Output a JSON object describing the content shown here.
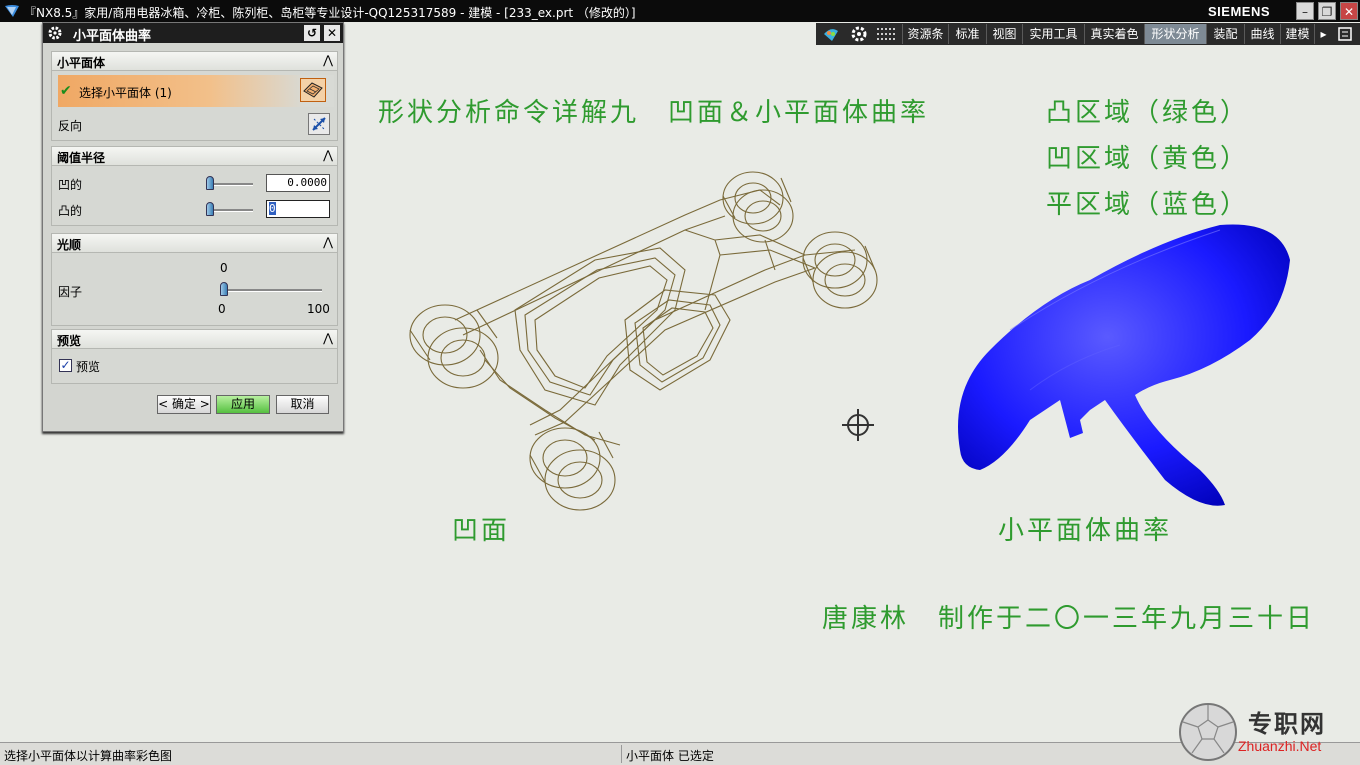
{
  "window": {
    "title": "『NX8.5』家用/商用电器冰箱、冷柜、陈列柜、岛柜等专业设计-QQ125317589 - 建模 - [233_ex.prt （修改的）]",
    "brand": "SIEMENS",
    "controls": {
      "minimize": "–",
      "restore": "❐",
      "close": "✕"
    }
  },
  "toolbar": {
    "items": [
      {
        "label": "资源条",
        "active": false
      },
      {
        "label": "标准",
        "active": false
      },
      {
        "label": "视图",
        "active": false
      },
      {
        "label": "实用工具",
        "active": false
      },
      {
        "label": "真实着色",
        "active": false
      },
      {
        "label": "形状分析",
        "active": true
      },
      {
        "label": "装配",
        "active": false
      },
      {
        "label": "曲线",
        "active": false
      },
      {
        "label": "建模",
        "active": false
      }
    ],
    "more": "▸"
  },
  "dialog": {
    "title": "小平面体曲率",
    "reset_icon": "↺",
    "close_icon": "✕",
    "facet_group": {
      "header": "小平面体",
      "select_label": "选择小平面体 (1)",
      "reverse_label": "反向"
    },
    "threshold_group": {
      "header": "阈值半径",
      "concave_label": "凹的",
      "concave_value": "0.0000",
      "convex_label": "凸的",
      "convex_value": "0"
    },
    "smooth_group": {
      "header": "光顺",
      "factor_label": "因子",
      "factor_value": "0",
      "min_label": "0",
      "max_label": "100",
      "factor_fraction": 0.0
    },
    "preview_group": {
      "header": "预览",
      "checkbox_label": "预览",
      "checked": true
    },
    "buttons": {
      "ok": "< 确定 >",
      "apply": "应用",
      "cancel": "取消"
    }
  },
  "canvas": {
    "title": "形状分析命令详解九　凹面＆小平面体曲率",
    "legend": [
      "凸区域（绿色）",
      "凹区域（黄色）",
      "平区域（蓝色）"
    ],
    "left_caption": "凹面",
    "right_caption": "小平面体曲率",
    "credit": "唐康林　制作于二〇一三年九月三十日",
    "annotation_color": "#2f9b2f",
    "model_wire_color": "#7a6a3a",
    "facet_body_color": "#1a1aff"
  },
  "status": {
    "prompt": "选择小平面体以计算曲率彩色图",
    "info": "小平面体 已选定"
  },
  "watermark": {
    "text_cn": "专职网",
    "text_en": "Zhuanzhi.Net"
  }
}
